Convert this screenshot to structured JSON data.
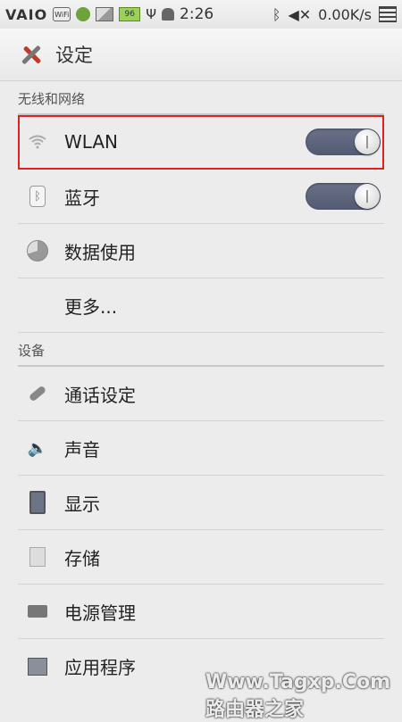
{
  "statusbar": {
    "brand": "VAIO",
    "wifi_badge": "WiFi",
    "battery_badge": "96",
    "time": "2:26",
    "speed": "0.00K/s"
  },
  "actionbar": {
    "title": "设定"
  },
  "sections": [
    {
      "header": "无线和网络",
      "items": [
        {
          "label": "WLAN",
          "icon": "wifi-icon",
          "toggle": true,
          "on": true,
          "highlighted": true
        },
        {
          "label": "蓝牙",
          "icon": "bluetooth-icon",
          "toggle": true,
          "on": true
        },
        {
          "label": "数据使用",
          "icon": "data-usage-icon"
        },
        {
          "label": "更多...",
          "icon": ""
        }
      ]
    },
    {
      "header": "设备",
      "items": [
        {
          "label": "通话设定",
          "icon": "phone-icon"
        },
        {
          "label": "声音",
          "icon": "speaker-icon"
        },
        {
          "label": "显示",
          "icon": "display-icon"
        },
        {
          "label": "存储",
          "icon": "storage-icon"
        },
        {
          "label": "电源管理",
          "icon": "battery-icon"
        },
        {
          "label": "应用程序",
          "icon": "apps-icon"
        }
      ]
    }
  ],
  "watermark": "Www.Tagxp.Com 路由器之家",
  "colors": {
    "highlight": "#dd2222",
    "toggle": "#5e6680",
    "background": "#ececec"
  }
}
